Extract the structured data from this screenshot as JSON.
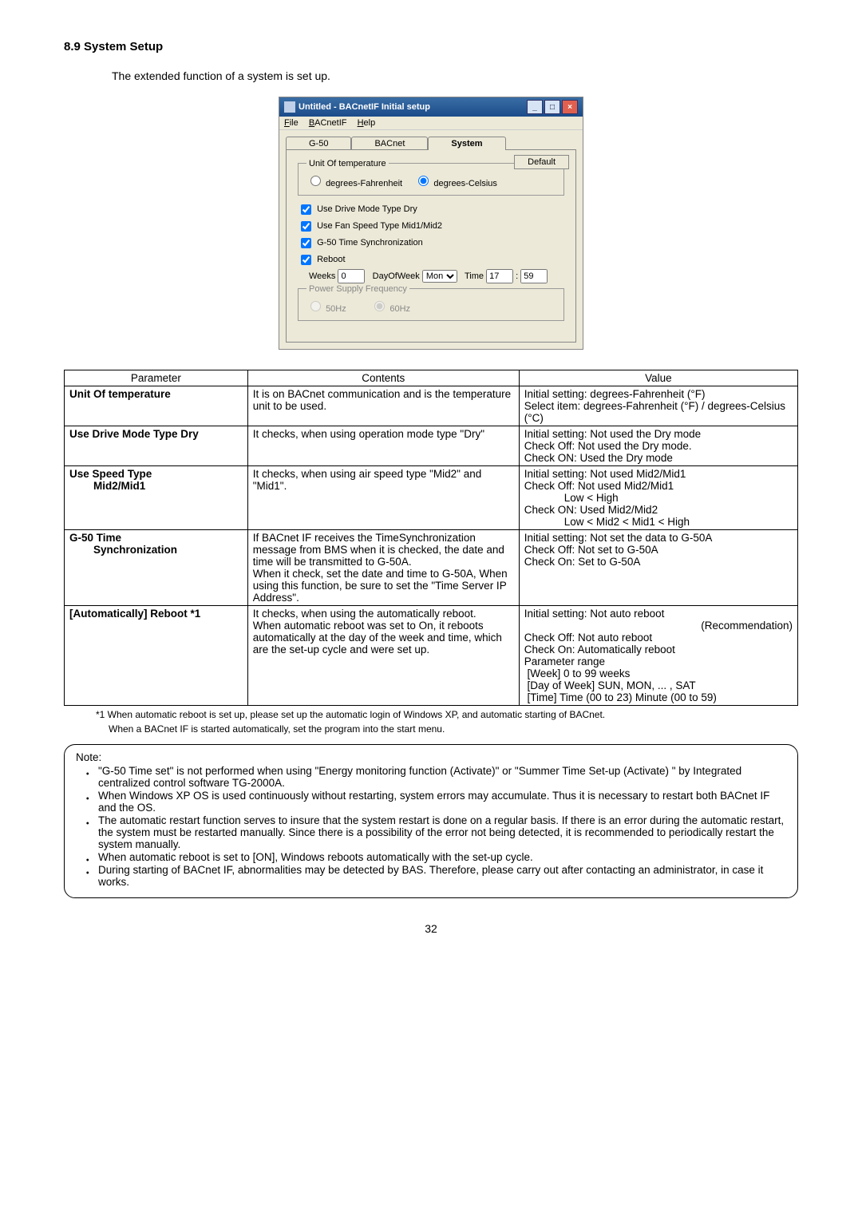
{
  "section": {
    "title": "8.9 System Setup",
    "intro": "The extended function of a system is set up."
  },
  "window": {
    "title": "Untitled - BACnetIF Initial setup",
    "menu": {
      "file": "File",
      "bacnetif": "BACnetIF",
      "help": "Help"
    },
    "tabs": {
      "g50": "G-50",
      "bacnet": "BACnet",
      "system": "System"
    },
    "default_btn": "Default",
    "unit_legend": "Unit Of temperature",
    "unit_f": "degrees-Fahrenheit",
    "unit_c": "degrees-Celsius",
    "chk_dry": "Use Drive Mode Type Dry",
    "chk_fan": "Use Fan Speed Type Mid1/Mid2",
    "chk_sync": "G-50 Time Synchronization",
    "chk_reboot": "Reboot",
    "weeks_lbl": "Weeks",
    "weeks_val": "0",
    "dow_lbl": "DayOfWeek",
    "dow_val": "Mon",
    "time_lbl": "Time",
    "time_h": "17",
    "time_m": "59",
    "psf_legend": "Power Supply Frequency",
    "psf_50": "50Hz",
    "psf_60": "60Hz"
  },
  "table": {
    "h1": "Parameter",
    "h2": "Contents",
    "h3": "Value",
    "r1p": "Unit Of temperature",
    "r1c": "It is on BACnet communication and is the temperature unit to be used.",
    "r1v": "Initial setting: degrees-Fahrenheit (°F)\nSelect item: degrees-Fahrenheit (°F) / degrees-Celsius (°C)",
    "r2p": "Use Drive Mode Type Dry",
    "r2c": "It checks, when using operation mode type \"Dry\"",
    "r2v": "Initial setting: Not used the Dry mode\nCheck Off: Not used the Dry mode.\nCheck ON: Used the Dry mode",
    "r3p1": "Use Speed Type",
    "r3p2": "Mid2/Mid1",
    "r3c": "It checks, when using air speed type \"Mid2\" and \"Mid1\".",
    "r3v1": "Initial setting: Not used Mid2/Mid1",
    "r3v2": "Check Off: Not used Mid2/Mid1",
    "r3v3": "Low < High",
    "r3v4": "Check ON: Used Mid2/Mid2",
    "r3v5": "Low < Mid2 < Mid1 < High",
    "r4p1": "G-50 Time",
    "r4p2": "Synchronization",
    "r4c": "If BACnet IF receives the TimeSynchronization message from BMS when it is checked, the date and time will be transmitted to G-50A.\nWhen it check, set the date and time to G-50A, When using this function, be sure to set the \"Time Server IP Address\".",
    "r4v": "Initial setting: Not set the data to G-50A\nCheck Off: Not set to G-50A\nCheck On: Set to G-50A",
    "r5p": "[Automatically] Reboot *1",
    "r5c": "It checks, when using the automatically reboot.\nWhen automatic reboot was set to On, it reboots automatically at the day of the week and time, which are the set-up cycle and were set up.",
    "r5v1": "Initial setting: Not auto reboot",
    "r5v2": "(Recommendation)",
    "r5v3": "Check Off: Not auto reboot",
    "r5v4": "Check On: Automatically reboot",
    "r5v5": "Parameter range",
    "r5v6": "[Week] 0 to 99 weeks",
    "r5v7": "[Day of Week] SUN, MON, ... , SAT",
    "r5v8": "[Time] Time (00 to 23) Minute (00 to 59)"
  },
  "footnotes": {
    "f1": "*1 When automatic reboot is set up, please set up the automatic login of Windows XP, and automatic starting of BACnet.",
    "f2": "When a BACnet IF is started automatically, set the program into the start menu."
  },
  "note": {
    "title": "Note:",
    "n1": "\"G-50 Time set\" is not performed when using \"Energy monitoring function (Activate)\" or \"Summer Time Set-up (Activate) \" by Integrated centralized control software TG-2000A.",
    "n2": "When Windows XP OS is used continuously without restarting, system errors may accumulate. Thus it is necessary to restart both BACnet IF and the OS.",
    "n3": "The automatic restart function serves to insure that the system restart is done on a regular basis. If there is an error during the automatic restart, the system must be restarted manually. Since there is a possibility of the error not being detected, it is recommended to periodically restart the system manually.",
    "n4": "When automatic reboot is set to [ON], Windows reboots automatically with the set-up cycle.",
    "n5": "During starting of BACnet IF, abnormalities may be detected by BAS. Therefore, please carry out after contacting an administrator, in case it works."
  },
  "page": "32"
}
